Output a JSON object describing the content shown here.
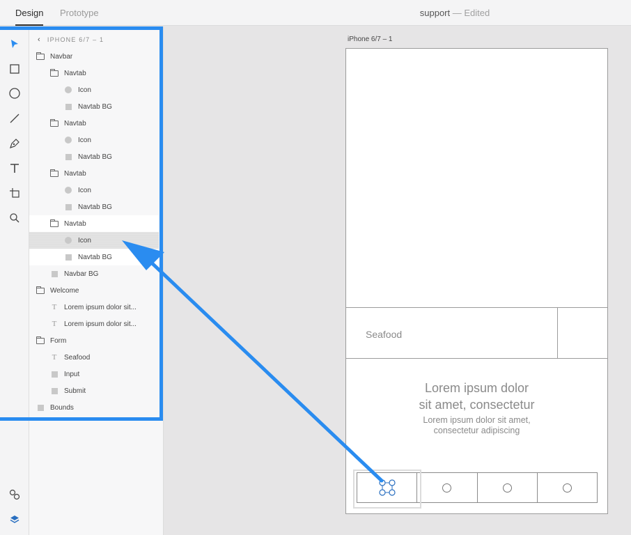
{
  "tabs": {
    "design": "Design",
    "prototype": "Prototype"
  },
  "doc": {
    "name": "support",
    "status": "— Edited"
  },
  "tools": [
    "select-tool",
    "rectangle-tool",
    "ellipse-tool",
    "line-tool",
    "pen-tool",
    "text-tool",
    "artboard-tool",
    "zoom-tool"
  ],
  "bottom_tools": [
    "symbols",
    "layers"
  ],
  "layers": {
    "header": "IPHONE 6/7 – 1",
    "rows": [
      {
        "label": "Navbar",
        "icon": "folder"
      },
      {
        "label": "Navtab",
        "icon": "folder"
      },
      {
        "label": "Icon",
        "icon": "ellipse"
      },
      {
        "label": "Navtab BG",
        "icon": "rectangle"
      },
      {
        "label": "Navtab",
        "icon": "folder"
      },
      {
        "label": "Icon",
        "icon": "ellipse"
      },
      {
        "label": "Navtab BG",
        "icon": "rectangle"
      },
      {
        "label": "Navtab",
        "icon": "folder"
      },
      {
        "label": "Icon",
        "icon": "ellipse"
      },
      {
        "label": "Navtab BG",
        "icon": "rectangle"
      },
      {
        "label": "Navtab",
        "icon": "folder"
      },
      {
        "label": "Icon",
        "icon": "ellipse"
      },
      {
        "label": "Navtab BG",
        "icon": "rectangle"
      },
      {
        "label": "Navbar BG",
        "icon": "rectangle"
      },
      {
        "label": "Welcome",
        "icon": "folder"
      },
      {
        "label": "Lorem ipsum dolor sit...",
        "icon": "text"
      },
      {
        "label": "Lorem ipsum dolor sit...",
        "icon": "text"
      },
      {
        "label": "Form",
        "icon": "folder"
      },
      {
        "label": "Seafood",
        "icon": "text"
      },
      {
        "label": "Input",
        "icon": "rectangle"
      },
      {
        "label": "Submit",
        "icon": "rectangle"
      },
      {
        "label": "Bounds",
        "icon": "rectangle"
      }
    ],
    "selected_row": 11
  },
  "artboard": {
    "name": "iPhone 6/7 – 1",
    "input_placeholder": "Seafood",
    "welcome_title": [
      "Lorem ipsum dolor",
      "sit amet, consectetur"
    ],
    "welcome_sub": [
      "Lorem ipsum dolor sit amet,",
      "consectetur adipiscing"
    ]
  },
  "colors": {
    "accent": "#2a8cf0",
    "selection_fill": "#e3e3e3"
  }
}
